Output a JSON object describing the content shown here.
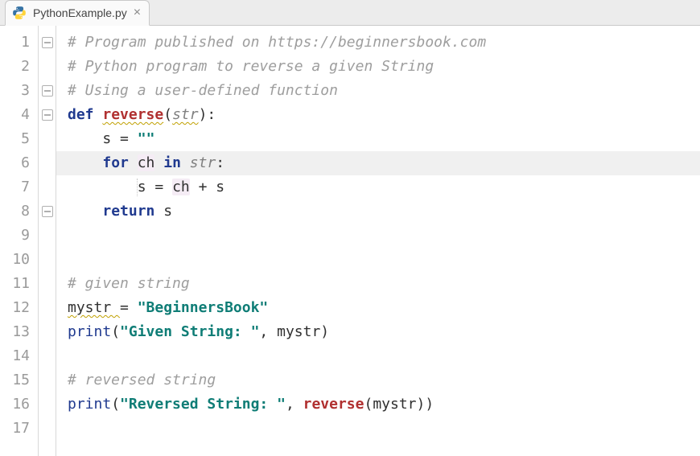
{
  "tab": {
    "filename": "PythonExample.py",
    "close_glyph": "×",
    "icon_name": "python-file-icon"
  },
  "editor": {
    "current_line": 6,
    "lines": [
      {
        "n": 1,
        "fold": "open",
        "indent": 0,
        "tokens": [
          {
            "t": "# Program published on https://beginnersbook.com",
            "c": "comment"
          }
        ]
      },
      {
        "n": 2,
        "fold": null,
        "indent": 0,
        "tokens": [
          {
            "t": "# Python program to reverse a given String",
            "c": "comment"
          }
        ]
      },
      {
        "n": 3,
        "fold": "close",
        "indent": 0,
        "tokens": [
          {
            "t": "# Using a user-defined function",
            "c": "comment"
          }
        ]
      },
      {
        "n": 4,
        "fold": "open",
        "indent": 0,
        "tokens": [
          {
            "t": "def ",
            "c": "kw"
          },
          {
            "t": "reverse",
            "c": "func",
            "wavy": true
          },
          {
            "t": "(",
            "c": "punct"
          },
          {
            "t": "str",
            "c": "param",
            "wavy": true
          },
          {
            "t": ")",
            "c": "punct"
          },
          {
            "t": ":",
            "c": "punct"
          }
        ]
      },
      {
        "n": 5,
        "fold": null,
        "indent": 1,
        "tokens": [
          {
            "t": "s ",
            "c": "ident"
          },
          {
            "t": "= ",
            "c": "op"
          },
          {
            "t": "\"\"",
            "c": "str"
          }
        ]
      },
      {
        "n": 6,
        "fold": null,
        "indent": 1,
        "tokens": [
          {
            "t": "for ",
            "c": "kw"
          },
          {
            "t": "ch",
            "c": "ident",
            "hl": true
          },
          {
            "t": " in ",
            "c": "kw"
          },
          {
            "t": "str",
            "c": "param"
          },
          {
            "t": ":",
            "c": "punct"
          }
        ]
      },
      {
        "n": 7,
        "fold": null,
        "indent": 2,
        "tokens": [
          {
            "t": "s ",
            "c": "ident"
          },
          {
            "t": "= ",
            "c": "op"
          },
          {
            "t": "ch",
            "c": "ident",
            "hl": true
          },
          {
            "t": " + ",
            "c": "op"
          },
          {
            "t": "s",
            "c": "ident"
          }
        ]
      },
      {
        "n": 8,
        "fold": "close",
        "indent": 1,
        "tokens": [
          {
            "t": "return ",
            "c": "kw"
          },
          {
            "t": "s",
            "c": "ident"
          }
        ]
      },
      {
        "n": 9,
        "fold": null,
        "indent": 0,
        "tokens": []
      },
      {
        "n": 10,
        "fold": null,
        "indent": 0,
        "tokens": []
      },
      {
        "n": 11,
        "fold": null,
        "indent": 0,
        "tokens": [
          {
            "t": "# given string",
            "c": "comment"
          }
        ]
      },
      {
        "n": 12,
        "fold": null,
        "indent": 0,
        "tokens": [
          {
            "t": "mystr ",
            "c": "ident",
            "wavy": true
          },
          {
            "t": "= ",
            "c": "op"
          },
          {
            "t": "\"BeginnersBook\"",
            "c": "str"
          }
        ]
      },
      {
        "n": 13,
        "fold": null,
        "indent": 0,
        "tokens": [
          {
            "t": "print",
            "c": "builtin"
          },
          {
            "t": "(",
            "c": "punct"
          },
          {
            "t": "\"Given String: \"",
            "c": "str"
          },
          {
            "t": ", ",
            "c": "punct"
          },
          {
            "t": "mystr",
            "c": "ident"
          },
          {
            "t": ")",
            "c": "punct"
          }
        ]
      },
      {
        "n": 14,
        "fold": null,
        "indent": 0,
        "tokens": []
      },
      {
        "n": 15,
        "fold": null,
        "indent": 0,
        "tokens": [
          {
            "t": "# reversed string",
            "c": "comment"
          }
        ]
      },
      {
        "n": 16,
        "fold": null,
        "indent": 0,
        "tokens": [
          {
            "t": "print",
            "c": "builtin"
          },
          {
            "t": "(",
            "c": "punct"
          },
          {
            "t": "\"Reversed String: \"",
            "c": "str"
          },
          {
            "t": ", ",
            "c": "punct"
          },
          {
            "t": "reverse",
            "c": "func"
          },
          {
            "t": "(",
            "c": "punct"
          },
          {
            "t": "mystr",
            "c": "ident"
          },
          {
            "t": ")",
            "c": "punct"
          },
          {
            "t": ")",
            "c": "punct"
          }
        ]
      },
      {
        "n": 17,
        "fold": null,
        "indent": 0,
        "tokens": []
      }
    ]
  }
}
